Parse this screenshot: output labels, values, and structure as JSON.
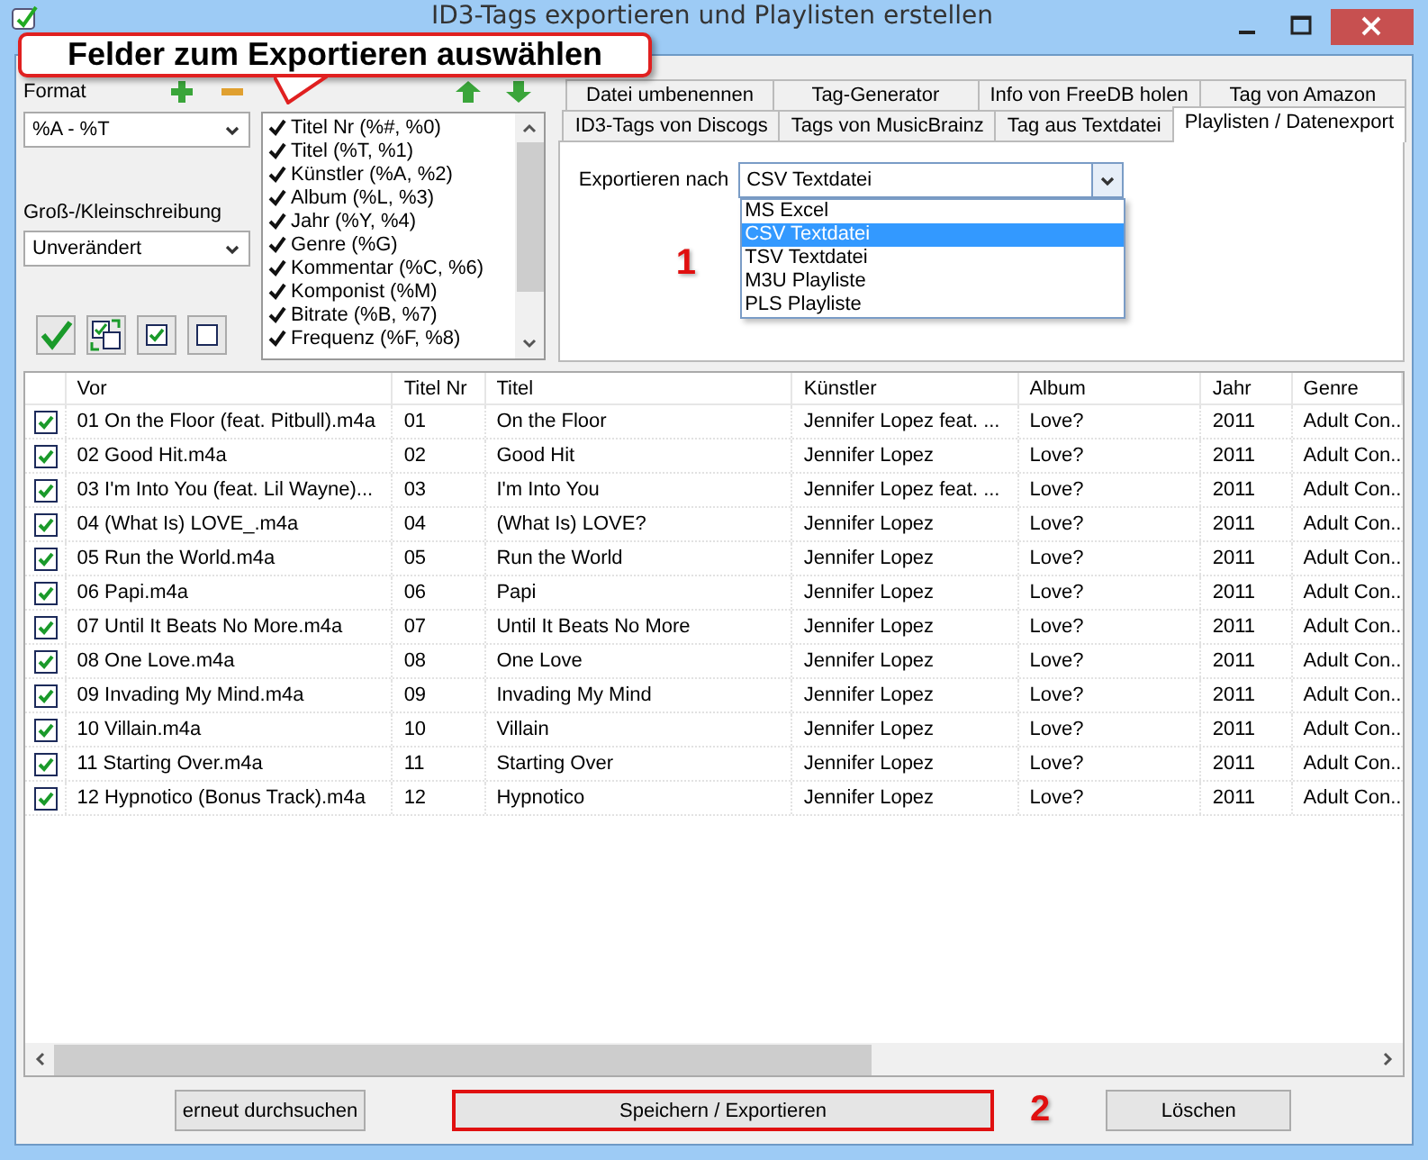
{
  "window": {
    "title": "ID3-Tags exportieren und Playlisten erstellen"
  },
  "callout": {
    "text": "Felder zum Exportieren auswählen"
  },
  "format": {
    "label": "Format",
    "value": "%A - %T"
  },
  "case": {
    "label": "Groß-/Kleinschreibung",
    "value": "Unverändert"
  },
  "fields": [
    {
      "label": "Titel Nr (%#, %0)",
      "checked": true
    },
    {
      "label": "Titel (%T, %1)",
      "checked": true
    },
    {
      "label": "Künstler (%A, %2)",
      "checked": true
    },
    {
      "label": "Album (%L, %3)",
      "checked": true
    },
    {
      "label": "Jahr (%Y, %4)",
      "checked": true
    },
    {
      "label": "Genre (%G)",
      "checked": true
    },
    {
      "label": "Kommentar (%C, %6)",
      "checked": true
    },
    {
      "label": "Komponist (%M)",
      "checked": true
    },
    {
      "label": "Bitrate (%B, %7)",
      "checked": true
    },
    {
      "label": "Frequenz (%F, %8)",
      "checked": true
    }
  ],
  "tab_rows": [
    [
      {
        "label": "Datei umbenennen",
        "selected": false
      },
      {
        "label": "Tag-Generator",
        "selected": false
      },
      {
        "label": "Info von FreeDB holen",
        "selected": false
      },
      {
        "label": "Tag von Amazon",
        "selected": false
      }
    ],
    [
      {
        "label": "ID3-Tags von Discogs",
        "selected": false
      },
      {
        "label": "Tags von MusicBrainz",
        "selected": false
      },
      {
        "label": "Tag aus Textdatei",
        "selected": false
      },
      {
        "label": "Playlisten / Datenexport",
        "selected": true
      }
    ]
  ],
  "export": {
    "label": "Exportieren nach",
    "value": "CSV Textdatei",
    "marker": "1",
    "options": [
      {
        "label": "MS Excel",
        "selected": false
      },
      {
        "label": "CSV Textdatei",
        "selected": true
      },
      {
        "label": "TSV Textdatei",
        "selected": false
      },
      {
        "label": "M3U Playliste",
        "selected": false
      },
      {
        "label": "PLS Playliste",
        "selected": false
      }
    ]
  },
  "table": {
    "columns": [
      "Vor",
      "Titel Nr",
      "Titel",
      "Künstler",
      "Album",
      "Jahr",
      "Genre"
    ],
    "rows": [
      {
        "checked": true,
        "cells": [
          "01 On the Floor (feat. Pitbull).m4a",
          "01",
          "On the Floor",
          "Jennifer Lopez feat. ...",
          "Love?",
          "2011",
          "Adult Con..."
        ]
      },
      {
        "checked": true,
        "cells": [
          "02 Good Hit.m4a",
          "02",
          "Good Hit",
          "Jennifer Lopez",
          "Love?",
          "2011",
          "Adult Con..."
        ]
      },
      {
        "checked": true,
        "cells": [
          "03 I'm Into You (feat. Lil Wayne)...",
          "03",
          "I'm Into You",
          "Jennifer Lopez feat. ...",
          "Love?",
          "2011",
          "Adult Con..."
        ]
      },
      {
        "checked": true,
        "cells": [
          "04 (What Is) LOVE_.m4a",
          "04",
          "(What Is) LOVE?",
          "Jennifer Lopez",
          "Love?",
          "2011",
          "Adult Con..."
        ]
      },
      {
        "checked": true,
        "cells": [
          "05 Run the World.m4a",
          "05",
          "Run the World",
          "Jennifer Lopez",
          "Love?",
          "2011",
          "Adult Con..."
        ]
      },
      {
        "checked": true,
        "cells": [
          "06 Papi.m4a",
          "06",
          "Papi",
          "Jennifer Lopez",
          "Love?",
          "2011",
          "Adult Con..."
        ]
      },
      {
        "checked": true,
        "cells": [
          "07 Until It Beats No More.m4a",
          "07",
          "Until It Beats No More",
          "Jennifer Lopez",
          "Love?",
          "2011",
          "Adult Con..."
        ]
      },
      {
        "checked": true,
        "cells": [
          "08 One Love.m4a",
          "08",
          "One Love",
          "Jennifer Lopez",
          "Love?",
          "2011",
          "Adult Con..."
        ]
      },
      {
        "checked": true,
        "cells": [
          "09 Invading My Mind.m4a",
          "09",
          "Invading My Mind",
          "Jennifer Lopez",
          "Love?",
          "2011",
          "Adult Con..."
        ]
      },
      {
        "checked": true,
        "cells": [
          "10 Villain.m4a",
          "10",
          "Villain",
          "Jennifer Lopez",
          "Love?",
          "2011",
          "Adult Con..."
        ]
      },
      {
        "checked": true,
        "cells": [
          "11 Starting Over.m4a",
          "11",
          "Starting Over",
          "Jennifer Lopez",
          "Love?",
          "2011",
          "Adult Con..."
        ]
      },
      {
        "checked": true,
        "cells": [
          "12 Hypnotico (Bonus Track).m4a",
          "12",
          "Hypnotico",
          "Jennifer Lopez",
          "Love?",
          "2011",
          "Adult Con..."
        ]
      }
    ]
  },
  "buttons": [
    {
      "label": "erneut durchsuchen",
      "highlighted": false
    },
    {
      "label": "Speichern / Exportieren",
      "highlighted": true
    },
    {
      "label": "Löschen",
      "highlighted": false
    }
  ],
  "buttons_marker": "2"
}
